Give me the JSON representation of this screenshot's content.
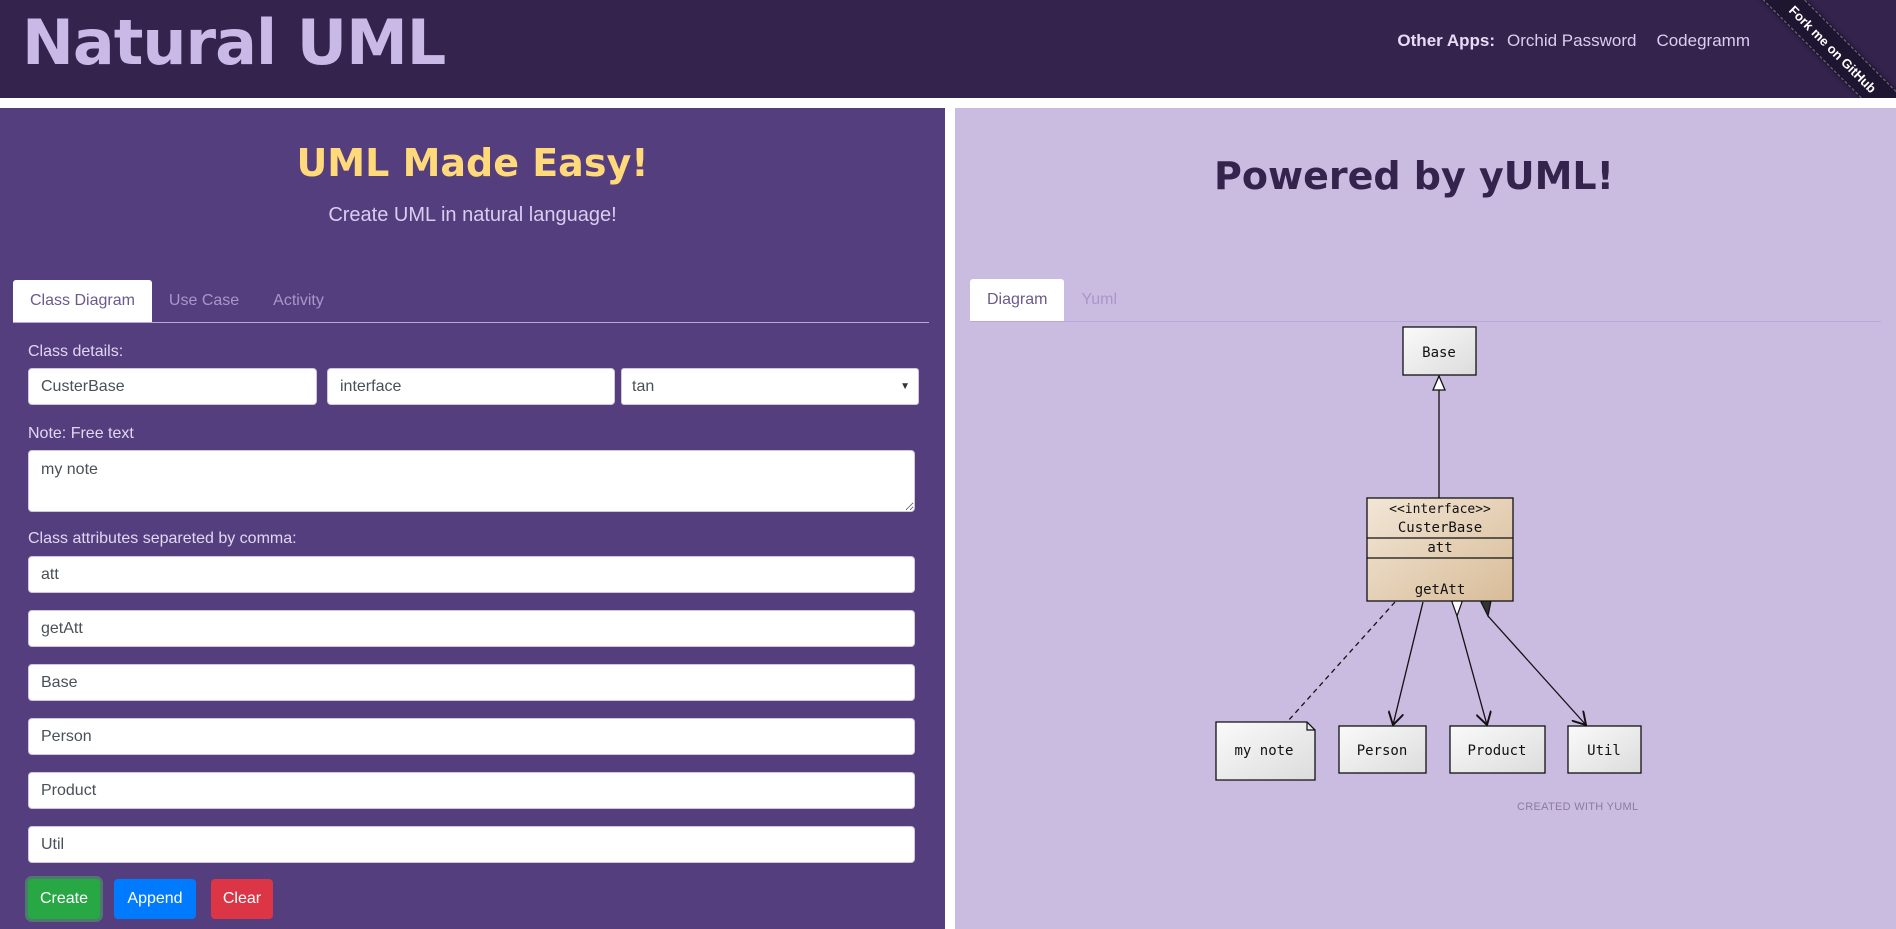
{
  "header": {
    "brand": "Natural UML",
    "other_apps_label": "Other Apps:",
    "links": [
      "Orchid Password",
      "Codegramm"
    ],
    "ribbon": "Fork me on GitHub"
  },
  "left": {
    "title": "UML Made Easy!",
    "subtitle": "Create UML in natural language!",
    "tabs": [
      "Class Diagram",
      "Use Case",
      "Activity"
    ],
    "class_details_label": "Class details:",
    "class_name": "CusterBase",
    "stereotype": "interface",
    "color_select": "tan",
    "note_label": "Note: Free text",
    "note_value": "my note",
    "attributes_label": "Class attributes separeted by comma:",
    "fields": [
      "att",
      "getAtt",
      "Base",
      "Person",
      "Product",
      "Util"
    ],
    "buttons": {
      "create": "Create",
      "append": "Append",
      "clear": "Clear"
    }
  },
  "right": {
    "title": "Powered by yUML!",
    "tabs": [
      "Diagram",
      "Yuml"
    ],
    "diagram": {
      "base": "Base",
      "stereotype": "<<interface>>",
      "class_name": "CusterBase",
      "attribute": "att",
      "method": "getAtt",
      "note": "my note",
      "targets": [
        "Person",
        "Product",
        "Util"
      ],
      "credit": "CREATED WITH YUML"
    }
  },
  "colors": {
    "header_bg": "#33234d",
    "left_bg": "#553e7d",
    "right_bg": "#cabbe1",
    "accent_yellow": "#ffd97a",
    "class_fill": "#e8d5bc"
  }
}
